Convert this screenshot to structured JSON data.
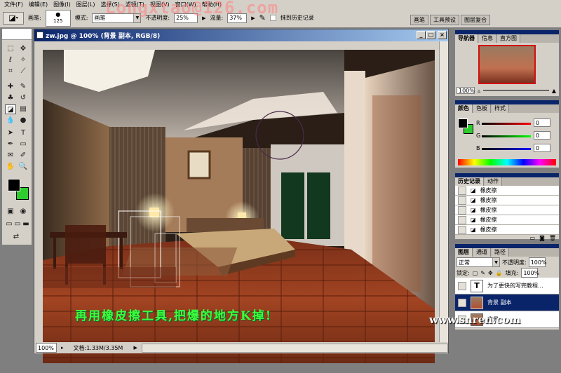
{
  "menu": [
    "文件(F)",
    "编辑(E)",
    "图像(I)",
    "图层(L)",
    "选择(S)",
    "滤镜(T)",
    "视图(V)",
    "窗口(W)",
    "帮助(H)"
  ],
  "watermark_text": "Longxtao@126.com",
  "options": {
    "brush_label": "画笔:",
    "brush_size": "125",
    "mode_label": "模式:",
    "mode_value": "画笔",
    "opacity_label": "不透明度:",
    "opacity_value": "25%",
    "flow_label": "流量:",
    "flow_value": "37%",
    "history_erase_label": "抹到历史记录"
  },
  "palette_well_tabs": [
    "画笔",
    "工具预设",
    "图层复合"
  ],
  "document": {
    "title": "zw.jpg @ 100% (背景 副本, RGB/8)",
    "zoom": "100%",
    "doc_size": "文档:1.33M/3.35M",
    "caption": "再用橡皮擦工具,把爆的地方K掉!"
  },
  "navigator": {
    "tabs": [
      "导航器",
      "信息",
      "直方图"
    ],
    "zoom": "100%"
  },
  "color": {
    "tabs": [
      "颜色",
      "色板",
      "样式"
    ],
    "r_label": "R",
    "r_value": "0",
    "g_label": "G",
    "g_value": "0",
    "b_label": "B",
    "b_value": "0",
    "fg": "#000000",
    "bg": "#2ecc2e"
  },
  "history": {
    "tabs": [
      "历史记录",
      "动作"
    ],
    "items": [
      "橡皮擦",
      "橡皮擦",
      "橡皮擦",
      "橡皮擦",
      "橡皮擦"
    ]
  },
  "layers": {
    "tabs": [
      "图层",
      "通道",
      "路径"
    ],
    "blend_mode": "正常",
    "opacity_label": "不透明度:",
    "opacity_value": "100%",
    "lock_label": "锁定:",
    "fill_label": "填充:",
    "fill_value": "100%",
    "items": [
      {
        "name": "为了更快的写完教程...",
        "type": "text"
      },
      {
        "name": "背景 副本",
        "type": "image"
      },
      {
        "name": "背景",
        "type": "image"
      }
    ]
  },
  "site_watermark": "www.snren.com"
}
